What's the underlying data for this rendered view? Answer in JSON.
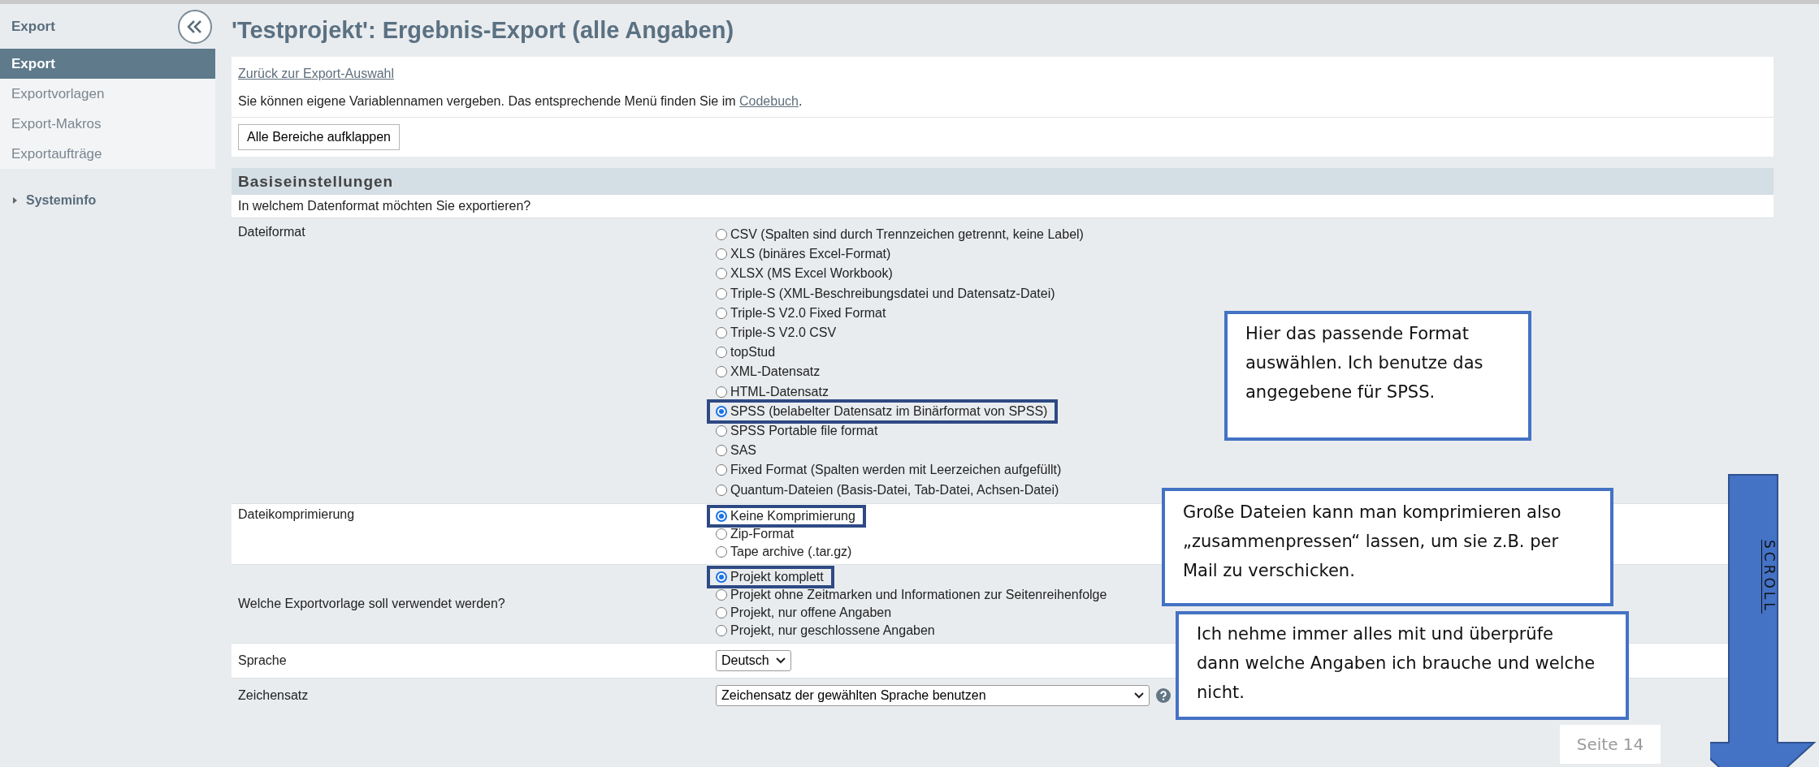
{
  "sidebar": {
    "heading": "Export",
    "items": [
      {
        "label": "Export",
        "selected": true
      },
      {
        "label": "Exportvorlagen",
        "selected": false
      },
      {
        "label": "Export-Makros",
        "selected": false
      },
      {
        "label": "Exportaufträge",
        "selected": false
      }
    ],
    "sections": [
      {
        "label": "Systeminfo",
        "expanded": false
      }
    ]
  },
  "title": "'Testprojekt': Ergebnis-Export (alle Angaben)",
  "back_link": "Zurück zur Export-Auswahl",
  "info": {
    "text": "Sie können eigene Variablennamen vergeben. Das entsprechende Menü finden Sie im ",
    "link": "Codebuch",
    "after": "."
  },
  "expand_button": "Alle Bereiche aufklappen",
  "section": {
    "title": "Basiseinstellungen",
    "question": "In welchem Datenformat möchten Sie exportieren?"
  },
  "settings": [
    {
      "kind": "radio",
      "label": "Dateiformat",
      "options": [
        {
          "label": "CSV (Spalten sind durch Trennzeichen getrennt, keine Label)",
          "selected": false,
          "highlighted": false
        },
        {
          "label": "XLS (binäres Excel-Format)",
          "selected": false,
          "highlighted": false
        },
        {
          "label": "XLSX (MS Excel Workbook)",
          "selected": false,
          "highlighted": false
        },
        {
          "label": "Triple-S (XML-Beschreibungsdatei und Datensatz-Datei)",
          "selected": false,
          "highlighted": false
        },
        {
          "label": "Triple-S V2.0 Fixed Format",
          "selected": false,
          "highlighted": false
        },
        {
          "label": "Triple-S V2.0 CSV",
          "selected": false,
          "highlighted": false
        },
        {
          "label": "topStud",
          "selected": false,
          "highlighted": false
        },
        {
          "label": "XML-Datensatz",
          "selected": false,
          "highlighted": false
        },
        {
          "label": "HTML-Datensatz",
          "selected": false,
          "highlighted": false
        },
        {
          "label": "SPSS (belabelter Datensatz im Binärformat von SPSS)",
          "selected": true,
          "highlighted": true
        },
        {
          "label": "SPSS Portable file format",
          "selected": false,
          "highlighted": false
        },
        {
          "label": "SAS",
          "selected": false,
          "highlighted": false
        },
        {
          "label": "Fixed Format (Spalten werden mit Leerzeichen aufgefüllt)",
          "selected": false,
          "highlighted": false
        },
        {
          "label": "Quantum-Dateien (Basis-Datei, Tab-Datei, Achsen-Datei)",
          "selected": false,
          "highlighted": false
        }
      ]
    },
    {
      "kind": "radio",
      "label": "Dateikomprimierung",
      "options": [
        {
          "label": "Keine Komprimierung",
          "selected": true,
          "highlighted": true
        },
        {
          "label": "Zip-Format",
          "selected": false,
          "highlighted": false
        },
        {
          "label": "Tape archive (.tar.gz)",
          "selected": false,
          "highlighted": false
        }
      ]
    },
    {
      "kind": "radio",
      "label": "Welche Exportvorlage soll verwendet werden?",
      "options": [
        {
          "label": "Projekt komplett",
          "selected": true,
          "highlighted": true
        },
        {
          "label": "Projekt ohne Zeitmarken und Informationen zur Seitenreihenfolge",
          "selected": false,
          "highlighted": false
        },
        {
          "label": "Projekt, nur offene Angaben",
          "selected": false,
          "highlighted": false
        },
        {
          "label": "Projekt, nur geschlossene Angaben",
          "selected": false,
          "highlighted": false
        }
      ]
    },
    {
      "kind": "select",
      "label": "Sprache",
      "value": "Deutsch",
      "help": false
    },
    {
      "kind": "select",
      "label": "Zeichensatz",
      "value": "Zeichensatz der gewählten Sprache benutzen",
      "help": true
    }
  ],
  "callouts": [
    "Hier das passende Format auswählen. Ich benutze das angegebene für SPSS.",
    "Große Dateien kann man komprimieren also „zusammenpressen“ lassen, um sie z.B. per Mail zu verschicken.",
    "Ich nehme immer alles mit und überprüfe dann welche Angaben ich brauche und welche nicht."
  ],
  "scroll_arrow": "SCROLL",
  "page_number": "Seite 14"
}
